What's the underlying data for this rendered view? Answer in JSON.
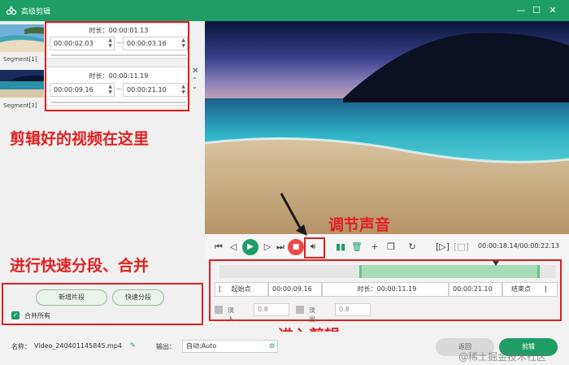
{
  "window": {
    "title": "高级剪辑"
  },
  "segments": [
    {
      "label": "Segment[1]",
      "duration": "时长：00:00:01.13",
      "start": "00:00:02.03",
      "end": "00:00:03.16"
    },
    {
      "label": "Segment[3]",
      "duration": "时长：00:00:11.19",
      "start": "00:00:09.16",
      "end": "00:00:21.10"
    }
  ],
  "segment_separator": "—",
  "annotations": {
    "edited_videos": "剪辑好的视频在这里",
    "adjust_sound": "调节声音",
    "split_merge": "进行快速分段、合并",
    "enter_edit": "进入剪辑"
  },
  "left_actions": {
    "new_segment": "新增片段",
    "quick_split": "快速分段",
    "merge_all": "合并所有"
  },
  "player": {
    "time": "00:00:18.14/00:00:22.13"
  },
  "trim": {
    "open_bracket": "[",
    "start_label": "起始点",
    "start_value": "00:00:09.16",
    "duration": "时长：00:00:11.19",
    "end_value": "00:00:21.10",
    "end_label": "结束点",
    "close_bracket": "]"
  },
  "fade": {
    "fade_in_label": "淡入",
    "fade_in_value": "0.8",
    "fade_out_label": "淡出",
    "fade_out_value": "0.8"
  },
  "bottom": {
    "name_label": "名称：",
    "file_name": "Video_240401145845.mp4",
    "output_label": "输出：",
    "output_value": "自动;Auto",
    "back_button": "返回",
    "edit_button": "剪辑"
  },
  "watermark": "@稀土掘金技术社区",
  "colors": {
    "accent": "#1f9d67",
    "annotation": "#e02020",
    "stop": "#e84a4a"
  },
  "icons": [
    "app-logo-icon",
    "minimize-icon",
    "maximize-icon",
    "close-icon",
    "play-icon",
    "stop-icon",
    "volume-icon",
    "delete-icon",
    "add-icon",
    "rotate-icon",
    "edit-pencil-icon",
    "gear-icon"
  ]
}
